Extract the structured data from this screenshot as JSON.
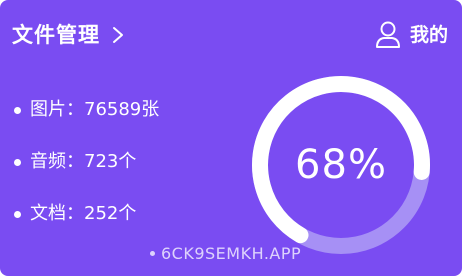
{
  "header": {
    "title": "文件管理",
    "mine_label": "我的"
  },
  "stats": [
    {
      "label": "图片：",
      "value": "76589张"
    },
    {
      "label": "音频：",
      "value": "723个"
    },
    {
      "label": "文档：",
      "value": "252个"
    }
  ],
  "gauge": {
    "label": "68%",
    "fraction": 0.68
  },
  "watermark": "6CK9SEMKH.APP",
  "icons": {
    "chevron": "chevron-right-icon",
    "user": "user-icon"
  },
  "colors": {
    "background": "#7a4cf2",
    "ring_track": "#a690f5",
    "ring_progress": "#ffffff"
  }
}
